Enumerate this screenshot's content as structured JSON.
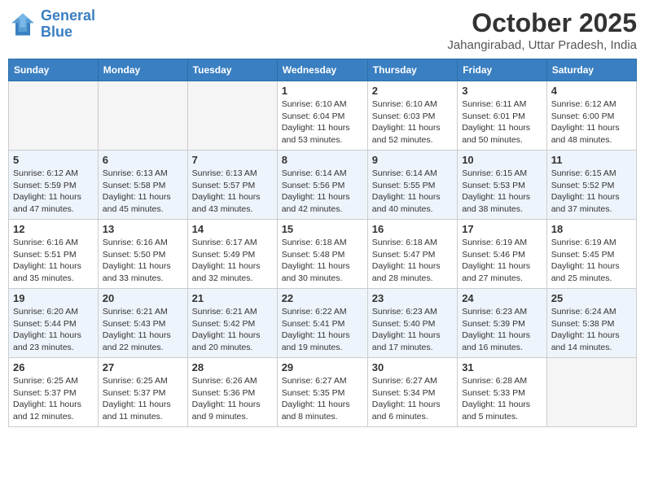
{
  "logo": {
    "line1": "General",
    "line2": "Blue"
  },
  "title": "October 2025",
  "location": "Jahangirabad, Uttar Pradesh, India",
  "days_of_week": [
    "Sunday",
    "Monday",
    "Tuesday",
    "Wednesday",
    "Thursday",
    "Friday",
    "Saturday"
  ],
  "weeks": [
    [
      {
        "day": "",
        "info": ""
      },
      {
        "day": "",
        "info": ""
      },
      {
        "day": "",
        "info": ""
      },
      {
        "day": "1",
        "info": "Sunrise: 6:10 AM\nSunset: 6:04 PM\nDaylight: 11 hours\nand 53 minutes."
      },
      {
        "day": "2",
        "info": "Sunrise: 6:10 AM\nSunset: 6:03 PM\nDaylight: 11 hours\nand 52 minutes."
      },
      {
        "day": "3",
        "info": "Sunrise: 6:11 AM\nSunset: 6:01 PM\nDaylight: 11 hours\nand 50 minutes."
      },
      {
        "day": "4",
        "info": "Sunrise: 6:12 AM\nSunset: 6:00 PM\nDaylight: 11 hours\nand 48 minutes."
      }
    ],
    [
      {
        "day": "5",
        "info": "Sunrise: 6:12 AM\nSunset: 5:59 PM\nDaylight: 11 hours\nand 47 minutes."
      },
      {
        "day": "6",
        "info": "Sunrise: 6:13 AM\nSunset: 5:58 PM\nDaylight: 11 hours\nand 45 minutes."
      },
      {
        "day": "7",
        "info": "Sunrise: 6:13 AM\nSunset: 5:57 PM\nDaylight: 11 hours\nand 43 minutes."
      },
      {
        "day": "8",
        "info": "Sunrise: 6:14 AM\nSunset: 5:56 PM\nDaylight: 11 hours\nand 42 minutes."
      },
      {
        "day": "9",
        "info": "Sunrise: 6:14 AM\nSunset: 5:55 PM\nDaylight: 11 hours\nand 40 minutes."
      },
      {
        "day": "10",
        "info": "Sunrise: 6:15 AM\nSunset: 5:53 PM\nDaylight: 11 hours\nand 38 minutes."
      },
      {
        "day": "11",
        "info": "Sunrise: 6:15 AM\nSunset: 5:52 PM\nDaylight: 11 hours\nand 37 minutes."
      }
    ],
    [
      {
        "day": "12",
        "info": "Sunrise: 6:16 AM\nSunset: 5:51 PM\nDaylight: 11 hours\nand 35 minutes."
      },
      {
        "day": "13",
        "info": "Sunrise: 6:16 AM\nSunset: 5:50 PM\nDaylight: 11 hours\nand 33 minutes."
      },
      {
        "day": "14",
        "info": "Sunrise: 6:17 AM\nSunset: 5:49 PM\nDaylight: 11 hours\nand 32 minutes."
      },
      {
        "day": "15",
        "info": "Sunrise: 6:18 AM\nSunset: 5:48 PM\nDaylight: 11 hours\nand 30 minutes."
      },
      {
        "day": "16",
        "info": "Sunrise: 6:18 AM\nSunset: 5:47 PM\nDaylight: 11 hours\nand 28 minutes."
      },
      {
        "day": "17",
        "info": "Sunrise: 6:19 AM\nSunset: 5:46 PM\nDaylight: 11 hours\nand 27 minutes."
      },
      {
        "day": "18",
        "info": "Sunrise: 6:19 AM\nSunset: 5:45 PM\nDaylight: 11 hours\nand 25 minutes."
      }
    ],
    [
      {
        "day": "19",
        "info": "Sunrise: 6:20 AM\nSunset: 5:44 PM\nDaylight: 11 hours\nand 23 minutes."
      },
      {
        "day": "20",
        "info": "Sunrise: 6:21 AM\nSunset: 5:43 PM\nDaylight: 11 hours\nand 22 minutes."
      },
      {
        "day": "21",
        "info": "Sunrise: 6:21 AM\nSunset: 5:42 PM\nDaylight: 11 hours\nand 20 minutes."
      },
      {
        "day": "22",
        "info": "Sunrise: 6:22 AM\nSunset: 5:41 PM\nDaylight: 11 hours\nand 19 minutes."
      },
      {
        "day": "23",
        "info": "Sunrise: 6:23 AM\nSunset: 5:40 PM\nDaylight: 11 hours\nand 17 minutes."
      },
      {
        "day": "24",
        "info": "Sunrise: 6:23 AM\nSunset: 5:39 PM\nDaylight: 11 hours\nand 16 minutes."
      },
      {
        "day": "25",
        "info": "Sunrise: 6:24 AM\nSunset: 5:38 PM\nDaylight: 11 hours\nand 14 minutes."
      }
    ],
    [
      {
        "day": "26",
        "info": "Sunrise: 6:25 AM\nSunset: 5:37 PM\nDaylight: 11 hours\nand 12 minutes."
      },
      {
        "day": "27",
        "info": "Sunrise: 6:25 AM\nSunset: 5:37 PM\nDaylight: 11 hours\nand 11 minutes."
      },
      {
        "day": "28",
        "info": "Sunrise: 6:26 AM\nSunset: 5:36 PM\nDaylight: 11 hours\nand 9 minutes."
      },
      {
        "day": "29",
        "info": "Sunrise: 6:27 AM\nSunset: 5:35 PM\nDaylight: 11 hours\nand 8 minutes."
      },
      {
        "day": "30",
        "info": "Sunrise: 6:27 AM\nSunset: 5:34 PM\nDaylight: 11 hours\nand 6 minutes."
      },
      {
        "day": "31",
        "info": "Sunrise: 6:28 AM\nSunset: 5:33 PM\nDaylight: 11 hours\nand 5 minutes."
      },
      {
        "day": "",
        "info": ""
      }
    ]
  ]
}
